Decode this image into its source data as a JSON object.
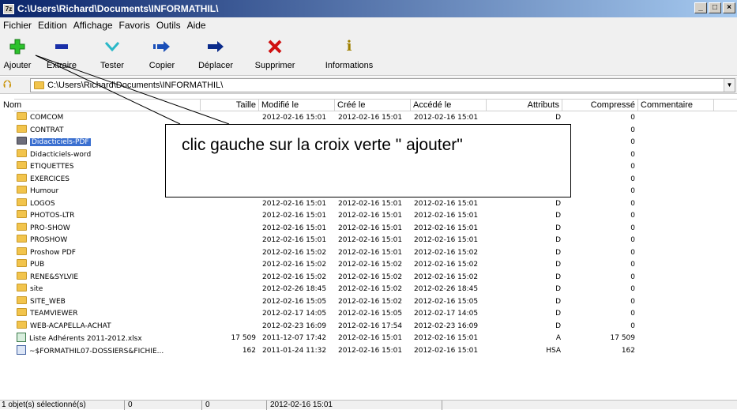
{
  "window": {
    "title": "C:\\Users\\Richard\\Documents\\INFORMATHIL\\"
  },
  "menu": [
    "Fichier",
    "Edition",
    "Affichage",
    "Favoris",
    "Outils",
    "Aide"
  ],
  "toolbar": [
    {
      "label": "Ajouter",
      "icon": "plus-icon",
      "color": "#22aa22"
    },
    {
      "label": "Extraire",
      "icon": "minus-icon",
      "color": "#1a2fa8"
    },
    {
      "label": "Tester",
      "icon": "check-icon",
      "color": "#2ab8c8"
    },
    {
      "label": "Copier",
      "icon": "copy-arrow-icon",
      "color": "#1a4fb8"
    },
    {
      "label": "Déplacer",
      "icon": "move-arrow-icon",
      "color": "#0a2a8a"
    },
    {
      "label": "Supprimer",
      "icon": "delete-x-icon",
      "color": "#d01010"
    },
    {
      "label": "Informations",
      "icon": "info-icon",
      "color": "#a08000"
    }
  ],
  "address": "C:\\Users\\Richard\\Documents\\INFORMATHIL\\",
  "columns": [
    "Nom",
    "Taille",
    "Modifié le",
    "Créé le",
    "Accédé le",
    "Attributs",
    "Compressé",
    "Commentaire"
  ],
  "files": [
    {
      "name": "COMCOM",
      "size": "",
      "modified": "2012-02-16 15:01",
      "created": "2012-02-16 15:01",
      "accessed": "2012-02-16 15:01",
      "attr": "D",
      "compressed": "0",
      "type": "folder"
    },
    {
      "name": "CONTRAT",
      "size": "",
      "modified": "",
      "created": "",
      "accessed": "",
      "attr": "",
      "compressed": "0",
      "type": "folder"
    },
    {
      "name": "Didacticiels-PDF",
      "size": "",
      "modified": "",
      "created": "",
      "accessed": "",
      "attr": "",
      "compressed": "0",
      "type": "folder-gray",
      "selected": true
    },
    {
      "name": "Didacticiels-word",
      "size": "",
      "modified": "",
      "created": "",
      "accessed": "",
      "attr": "",
      "compressed": "0",
      "type": "folder"
    },
    {
      "name": "ETIQUETTES",
      "size": "",
      "modified": "",
      "created": "",
      "accessed": "",
      "attr": "",
      "compressed": "0",
      "type": "folder"
    },
    {
      "name": "EXERCICES",
      "size": "",
      "modified": "",
      "created": "",
      "accessed": "",
      "attr": "",
      "compressed": "0",
      "type": "folder"
    },
    {
      "name": "Humour",
      "size": "",
      "modified": "",
      "created": "",
      "accessed": "",
      "attr": "",
      "compressed": "0",
      "type": "folder"
    },
    {
      "name": "LOGOS",
      "size": "",
      "modified": "2012-02-16 15:01",
      "created": "2012-02-16 15:01",
      "accessed": "2012-02-16 15:01",
      "attr": "D",
      "compressed": "0",
      "type": "folder"
    },
    {
      "name": "PHOTOS-LTR",
      "size": "",
      "modified": "2012-02-16 15:01",
      "created": "2012-02-16 15:01",
      "accessed": "2012-02-16 15:01",
      "attr": "D",
      "compressed": "0",
      "type": "folder"
    },
    {
      "name": "PRO-SHOW",
      "size": "",
      "modified": "2012-02-16 15:01",
      "created": "2012-02-16 15:01",
      "accessed": "2012-02-16 15:01",
      "attr": "D",
      "compressed": "0",
      "type": "folder"
    },
    {
      "name": "PROSHOW",
      "size": "",
      "modified": "2012-02-16 15:01",
      "created": "2012-02-16 15:01",
      "accessed": "2012-02-16 15:01",
      "attr": "D",
      "compressed": "0",
      "type": "folder"
    },
    {
      "name": "Proshow PDF",
      "size": "",
      "modified": "2012-02-16 15:02",
      "created": "2012-02-16 15:01",
      "accessed": "2012-02-16 15:02",
      "attr": "D",
      "compressed": "0",
      "type": "folder"
    },
    {
      "name": "PUB",
      "size": "",
      "modified": "2012-02-16 15:02",
      "created": "2012-02-16 15:02",
      "accessed": "2012-02-16 15:02",
      "attr": "D",
      "compressed": "0",
      "type": "folder"
    },
    {
      "name": "RENE&SYLVIE",
      "size": "",
      "modified": "2012-02-16 15:02",
      "created": "2012-02-16 15:02",
      "accessed": "2012-02-16 15:02",
      "attr": "D",
      "compressed": "0",
      "type": "folder"
    },
    {
      "name": "site",
      "size": "",
      "modified": "2012-02-26 18:45",
      "created": "2012-02-16 15:02",
      "accessed": "2012-02-26 18:45",
      "attr": "D",
      "compressed": "0",
      "type": "folder"
    },
    {
      "name": "SITE_WEB",
      "size": "",
      "modified": "2012-02-16 15:05",
      "created": "2012-02-16 15:02",
      "accessed": "2012-02-16 15:05",
      "attr": "D",
      "compressed": "0",
      "type": "folder"
    },
    {
      "name": "TEAMVIEWER",
      "size": "",
      "modified": "2012-02-17 14:05",
      "created": "2012-02-16 15:05",
      "accessed": "2012-02-17 14:05",
      "attr": "D",
      "compressed": "0",
      "type": "folder"
    },
    {
      "name": "WEB-ACAPELLA-ACHAT",
      "size": "",
      "modified": "2012-02-23 16:09",
      "created": "2012-02-16 17:54",
      "accessed": "2012-02-23 16:09",
      "attr": "D",
      "compressed": "0",
      "type": "folder"
    },
    {
      "name": "Liste Adhérents 2011-2012.xlsx",
      "size": "17 509",
      "modified": "2011-12-07 17:42",
      "created": "2012-02-16 15:01",
      "accessed": "2012-02-16 15:01",
      "attr": "A",
      "compressed": "17 509",
      "type": "xlsx"
    },
    {
      "name": "~$FORMATHIL07-DOSSIERS&FICHIE...",
      "size": "162",
      "modified": "2011-01-24 11:32",
      "created": "2012-02-16 15:01",
      "accessed": "2012-02-16 15:01",
      "attr": "HSA",
      "compressed": "162",
      "type": "doc"
    }
  ],
  "status": {
    "selection": "1 objet(s) sélectionné(s)",
    "size": "0",
    "packed": "0",
    "date": "2012-02-16 15:01"
  },
  "callout": {
    "text": "clic gauche sur la croix verte \" ajouter\""
  }
}
